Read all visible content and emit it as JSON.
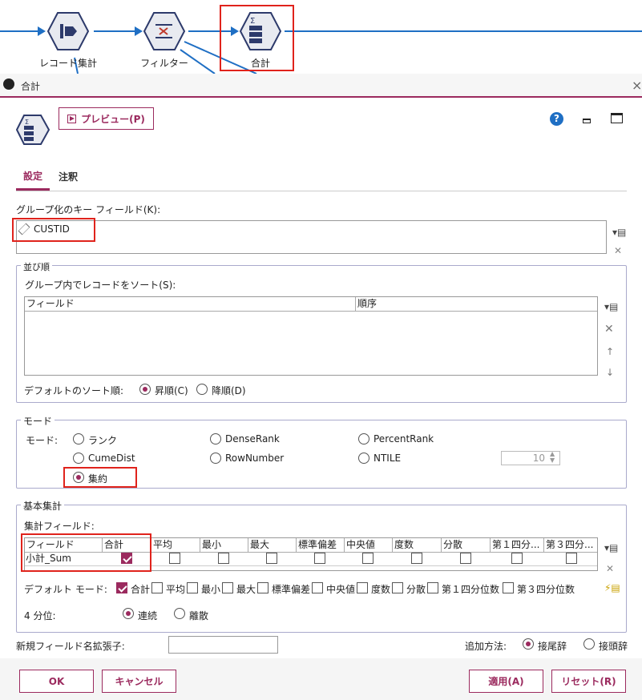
{
  "canvas": {
    "nodes": [
      {
        "label": "レコード集計",
        "icon": "record-aggregate-icon"
      },
      {
        "label": "フィルター",
        "icon": "filter-icon"
      },
      {
        "label": "合計",
        "icon": "summary-icon"
      }
    ]
  },
  "dialog": {
    "title": "合計",
    "preview_label": "プレビュー(P)",
    "help_label": "?",
    "tabs": [
      "設定",
      "注釈"
    ],
    "key_fields_label": "グループ化のキー フィールド(K):",
    "key_field_value": "CUSTID",
    "sort_group_label": "並び順",
    "sort_label": "グループ内でレコードをソート(S):",
    "sort_columns": [
      "フィールド",
      "順序"
    ],
    "default_sort_label": "デフォルトのソート順:",
    "sort_asc": "昇順(C)",
    "sort_desc": "降順(D)",
    "mode_group_label": "モード",
    "mode_label": "モード:",
    "modes": [
      "ランク",
      "DenseRank",
      "PercentRank",
      "CumeDist",
      "RowNumber",
      "NTILE",
      "集約"
    ],
    "ntile_value": "10",
    "basic_group_label": "基本集計",
    "agg_fields_label": "集計フィールド:",
    "agg_columns": [
      "フィールド",
      "合計",
      "平均",
      "最小",
      "最大",
      "標準偏差",
      "中央値",
      "度数",
      "分散",
      "第１四分...",
      "第３四分..."
    ],
    "agg_row_field": "小計_Sum",
    "default_mode_label": "デフォルト モード:",
    "default_modes": [
      "合計",
      "平均",
      "最小",
      "最大",
      "標準偏差",
      "中央値",
      "度数",
      "分散",
      "第１四分位数",
      "第３四分位数"
    ],
    "quartile_label": "4 分位:",
    "quartile_continuous": "連続",
    "quartile_discrete": "離散",
    "suffix_label": "新規フィールド名拡張子:",
    "suffix_value": "",
    "append_label": "追加方法:",
    "append_suffix": "接尾辞",
    "append_prefix": "接頭辞"
  },
  "footer": {
    "ok": "OK",
    "cancel": "キャンセル",
    "apply": "適用(A)",
    "reset": "リセット(R)"
  },
  "colors": {
    "accent": "#9b2a5e",
    "highlight": "#e0231c",
    "node": "#2d3a6b",
    "flow": "#1f6fc4"
  }
}
